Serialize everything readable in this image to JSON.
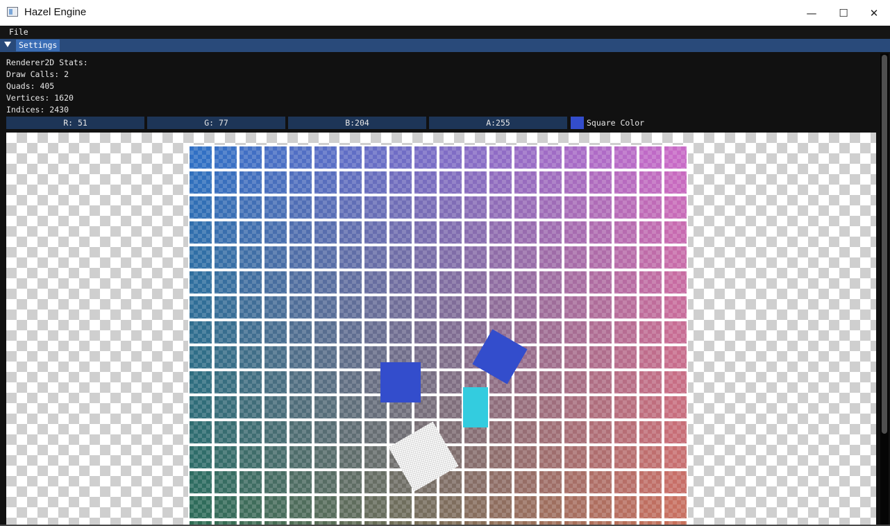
{
  "window": {
    "title": "Hazel Engine",
    "controls": {
      "minimize": "—",
      "maximize": "☐",
      "close": "✕"
    }
  },
  "menubar": {
    "file": "File"
  },
  "settings_panel": {
    "tab_label": "Settings",
    "stats": {
      "header": "Renderer2D Stats:",
      "draw_calls": "Draw Calls: 2",
      "quads": "Quads: 405",
      "vertices": "Vertices: 1620",
      "indices": "Indices: 2430"
    },
    "color_editor": {
      "r": "R: 51",
      "g": "G: 77",
      "b": "B:204",
      "a": "A:255",
      "label": "Square Color",
      "swatch_color": "#334dcc"
    }
  },
  "scene": {
    "grid": {
      "columns": 20,
      "rows": 16,
      "corner_colors": {
        "top_left": "#3170c4",
        "top_right": "#c76ac6",
        "bottom_left": "#2f6c53",
        "bottom_right": "#c7705a"
      }
    },
    "quads": {
      "square_color": "#334dcc",
      "rotated_color": "#334dcc",
      "cyan_color": "#33ccdf"
    }
  },
  "colors": {
    "menubar_bg": "#151515",
    "panel_header_bg": "#294a7a",
    "tab_bg": "#3a6db5",
    "panel_bg": "#111111",
    "field_bg": "#1d3557"
  }
}
